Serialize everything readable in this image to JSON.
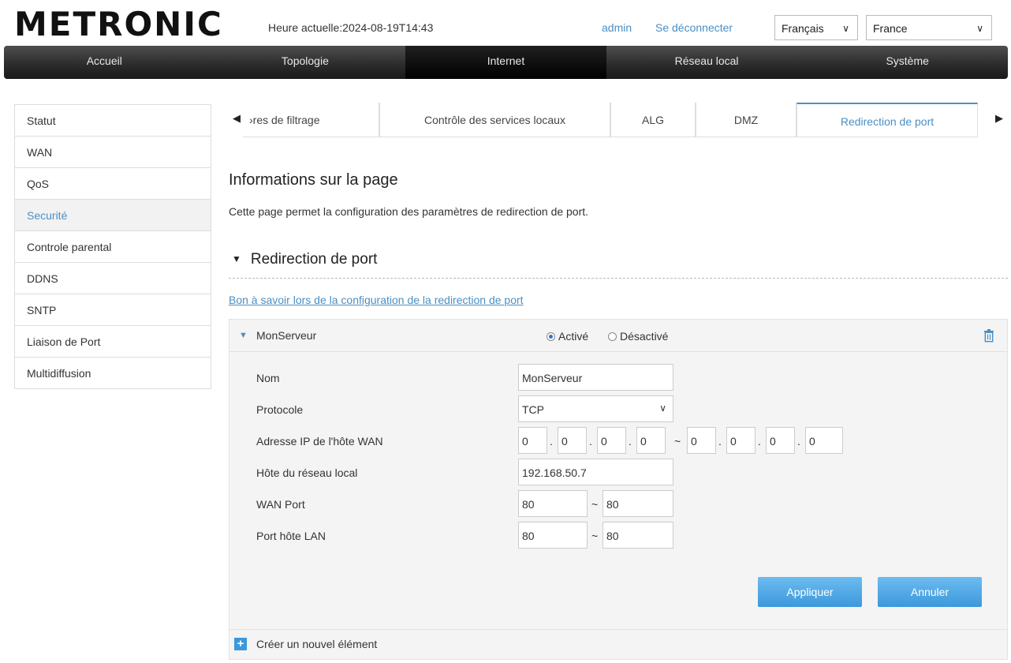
{
  "header": {
    "logo": "METRONIC",
    "time": "Heure actuelle:2024-08-19T14:43",
    "user": "admin",
    "logout": "Se déconnecter",
    "language": "Français",
    "country": "France"
  },
  "nav": [
    "Accueil",
    "Topologie",
    "Internet",
    "Réseau local",
    "Système"
  ],
  "sidebar": [
    "Statut",
    "WAN",
    "QoS",
    "Securité",
    "Controle parental",
    "DDNS",
    "SNTP",
    "Liaison de Port",
    "Multidiffusion"
  ],
  "tabs": [
    "›res de filtrage",
    "Contrôle des services locaux",
    "ALG",
    "DMZ",
    "Redirection de port"
  ],
  "content": {
    "title": "Informations sur la page",
    "description": "Cette page permet la configuration des paramètres de redirection de port.",
    "section_title": "Redirection de port",
    "help_link": "Bon à savoir lors de la configuration de la redirection de port"
  },
  "rule": {
    "name": "MonServeur",
    "enabled_label": "Activé",
    "disabled_label": "Désactivé",
    "fields": {
      "name_label": "Nom",
      "name_value": "MonServeur",
      "protocol_label": "Protocole",
      "protocol_value": "TCP",
      "wan_ip_label": "Adresse IP de l'hôte WAN",
      "wan_ip_start": [
        "0",
        "0",
        "0",
        "0"
      ],
      "wan_ip_end": [
        "0",
        "0",
        "0",
        "0"
      ],
      "lan_host_label": "Hôte du réseau local",
      "lan_host_value": "192.168.50.7",
      "wan_port_label": "WAN Port",
      "wan_port_start": "80",
      "wan_port_end": "80",
      "lan_port_label": "Port hôte LAN",
      "lan_port_start": "80",
      "lan_port_end": "80"
    },
    "apply_label": "Appliquer",
    "cancel_label": "Annuler"
  },
  "create_new": "Créer un nouvel élément",
  "colors": {
    "accent": "#4a8fc5",
    "button": "#3c98dc"
  }
}
